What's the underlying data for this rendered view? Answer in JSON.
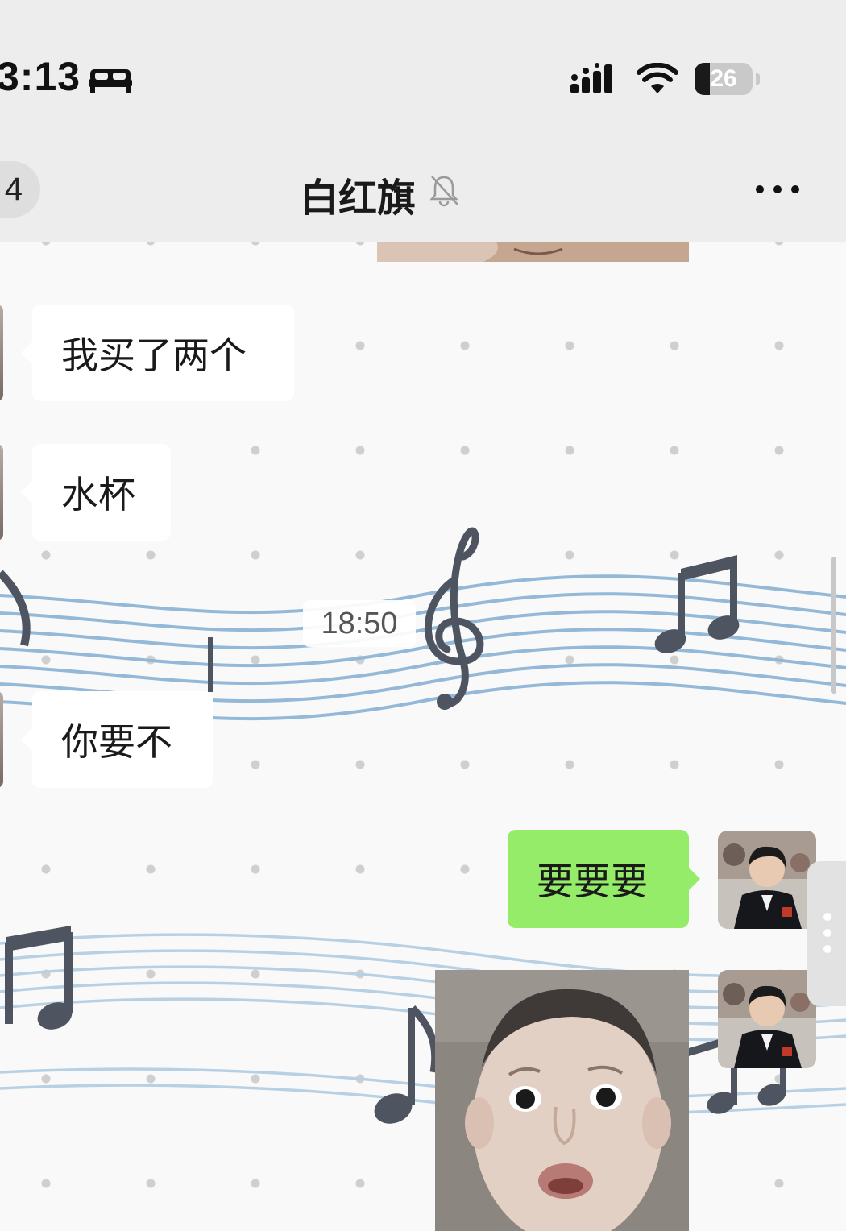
{
  "status_bar": {
    "time": "3:13",
    "battery_percent": "26",
    "battery_level": 0.26,
    "icons": [
      "bed-icon",
      "signal-icon",
      "wifi-icon",
      "battery-icon"
    ]
  },
  "nav": {
    "back_count": "4",
    "title": "白红旗",
    "icons": [
      "back-button",
      "mute-bell-icon",
      "more-options-icon"
    ]
  },
  "messages": [
    {
      "side": "in",
      "type": "text",
      "text": "我买了两个"
    },
    {
      "side": "in",
      "type": "text",
      "text": "水杯"
    },
    {
      "side": "in",
      "type": "text",
      "text": "你要不"
    },
    {
      "side": "out",
      "type": "text",
      "text": "要要要"
    },
    {
      "side": "out",
      "type": "sticker",
      "text": ""
    }
  ],
  "timestamp": "18:50",
  "colors": {
    "outgoing_bubble": "#95ec69",
    "incoming_bubble": "#ffffff",
    "bar_background": "#ededed",
    "staff_lines": "#8fb5d6",
    "notes": "#4e5560"
  }
}
